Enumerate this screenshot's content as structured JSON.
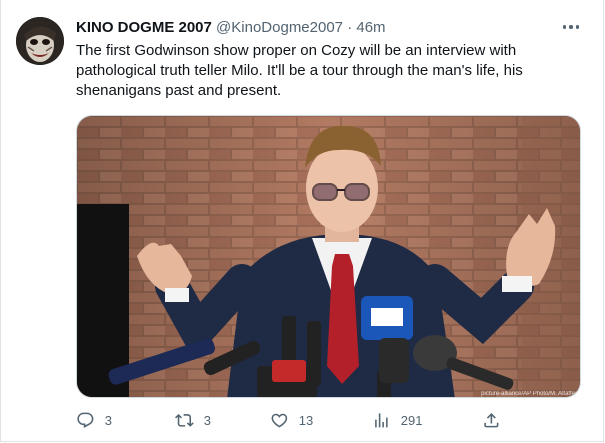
{
  "tweet": {
    "display_name": "KINO DOGME 2007",
    "handle": "@KinoDogme2007",
    "separator": "·",
    "time": "46m",
    "text": "The first Godwinson show proper on Cozy will be an interview with pathological truth teller Milo. It'll be a tour through the man's life, his shenanigans past and present.",
    "media_watermark": "picture-alliance/AP Photo/M. Altaffer",
    "more_icon": "more-dots-icon"
  },
  "actions": {
    "reply": {
      "icon": "reply-icon",
      "count": "3"
    },
    "retweet": {
      "icon": "retweet-icon",
      "count": "3"
    },
    "like": {
      "icon": "heart-icon",
      "count": "13"
    },
    "views": {
      "icon": "views-icon",
      "count": "291"
    },
    "share": {
      "icon": "share-icon"
    }
  },
  "colors": {
    "text_primary": "#0f1419",
    "text_secondary": "#536471",
    "border": "#cfd9de"
  }
}
